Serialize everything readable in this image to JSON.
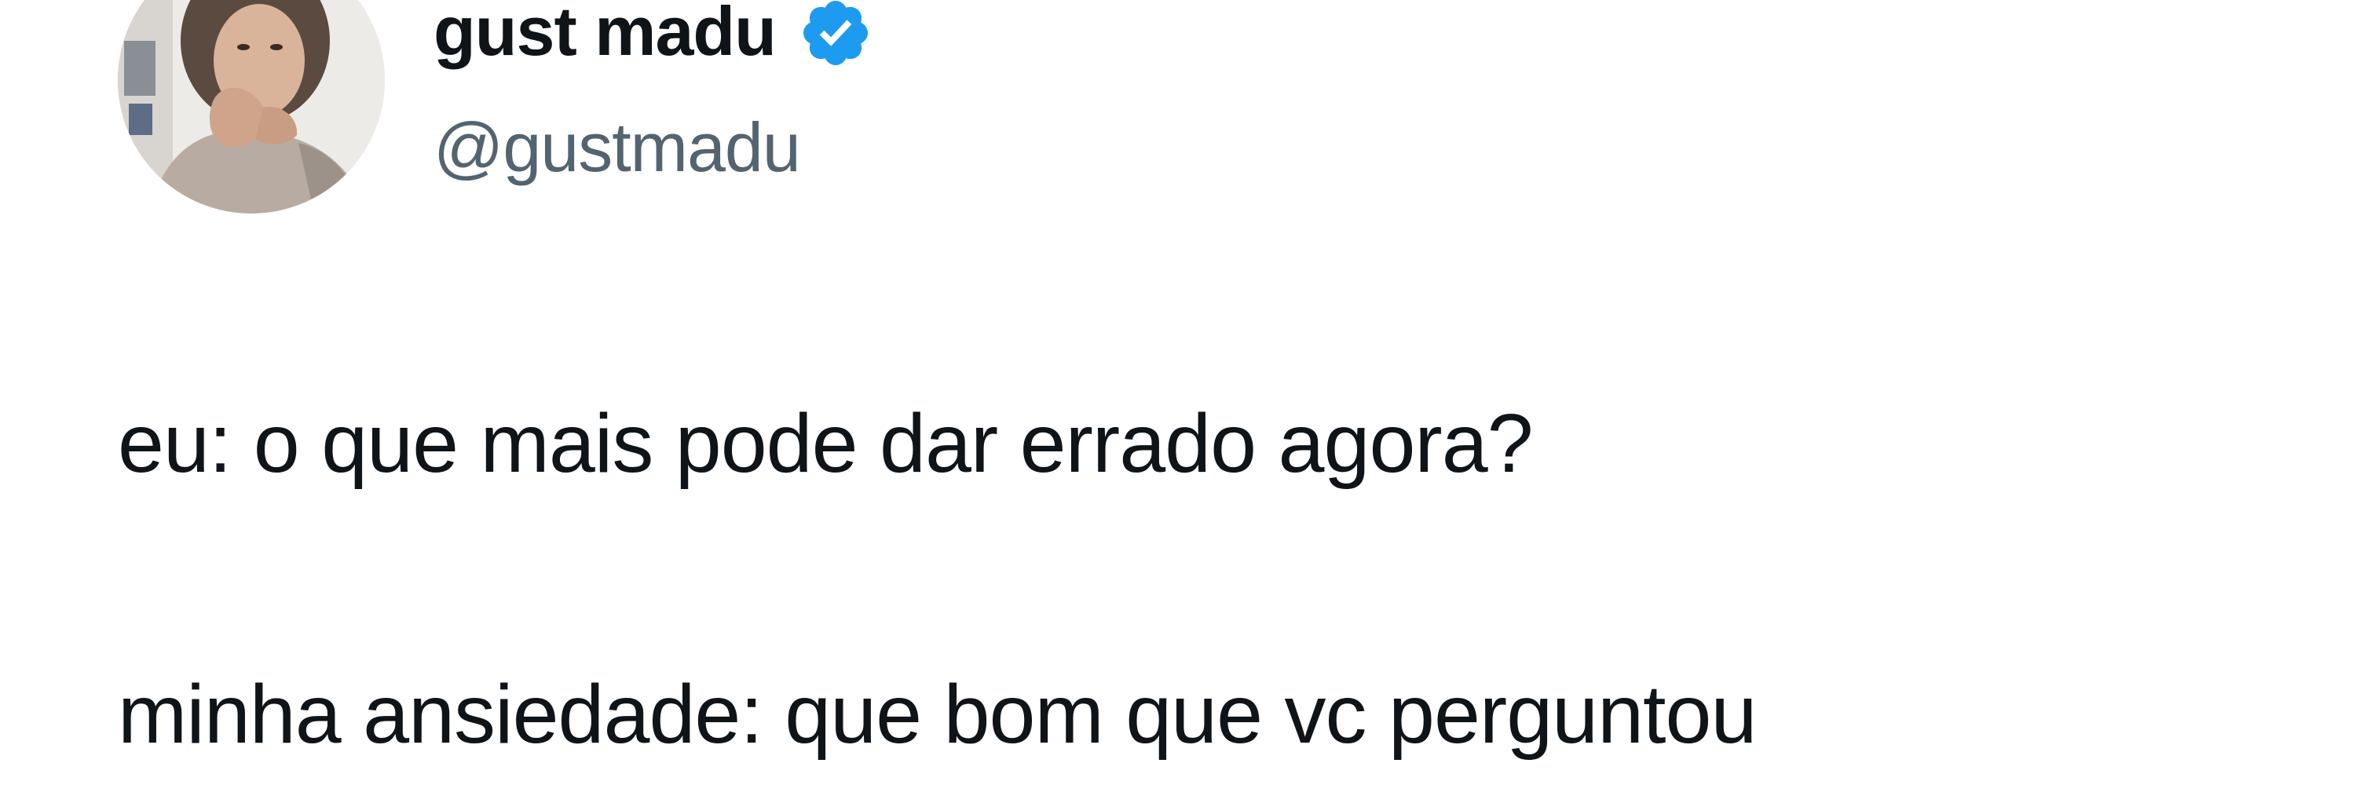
{
  "author": {
    "display_name": "gust madu",
    "handle": "@gustmadu",
    "verified_icon": "verified-badge-icon",
    "avatar": "profile-photo"
  },
  "tweet": {
    "lines": [
      "eu: o que mais pode dar errado agora?",
      "minha ansiedade: que bom que vc perguntou"
    ]
  },
  "colors": {
    "text_primary": "#0f1419",
    "text_secondary": "#536471",
    "verified_blue": "#1d9bf0",
    "background": "#ffffff"
  }
}
